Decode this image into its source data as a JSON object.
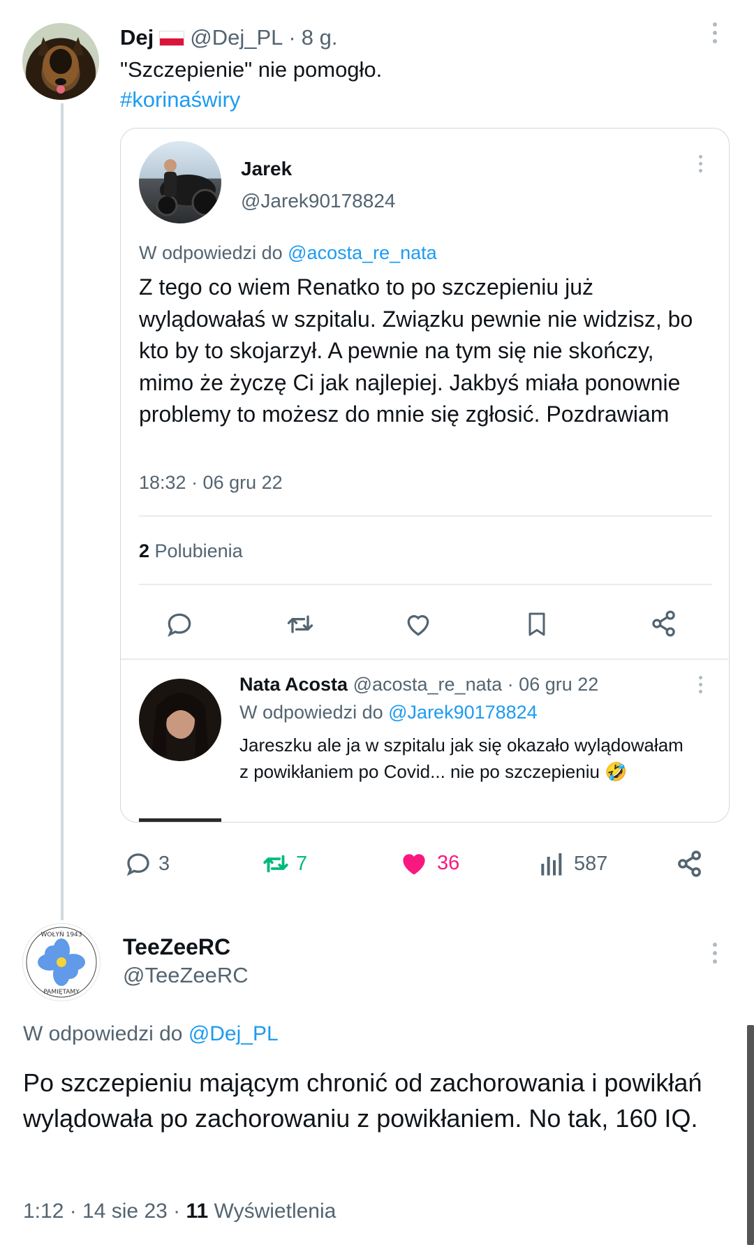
{
  "main_tweet": {
    "author_name": "Dej",
    "author_flag": "🇵🇱",
    "handle": "@Dej_PL",
    "dot": "·",
    "time": "8 g.",
    "text": "\"Szczepienie\" nie pomogło.",
    "hashtag": "#korinaświry",
    "stats": {
      "replies": "3",
      "retweets": "7",
      "likes": "36",
      "views": "587"
    }
  },
  "quoted_tweet": {
    "author_name": "Jarek",
    "handle": "@Jarek90178824",
    "reply_prefix": "W odpowiedzi do",
    "reply_to": "@acosta_re_nata",
    "text": "Z tego co wiem Renatko to po szczepieniu już wylądowałaś w szpitalu. Związku pewnie nie widzisz, bo kto by to skojarzył. A pewnie na tym się nie skończy, mimo że życzę Ci jak najlepiej. Jakbyś miała ponownie problemy to możesz do mnie się zgłosić. Pozdrawiam",
    "timestamp": "18:32 · 06 gru 22",
    "likes_count": "2",
    "likes_label": "Polubienia"
  },
  "nested_reply": {
    "author_name": "Nata Acosta",
    "handle": "@acosta_re_nata",
    "dot": "·",
    "date": "06 gru 22",
    "reply_prefix": "W odpowiedzi do",
    "reply_to": "@Jarek90178824",
    "text": "Jareszku ale ja w szpitalu jak się okazało wylądowałam z powikłaniem po Covid... nie po szczepieniu",
    "emoji": "🤣"
  },
  "reply_tweet": {
    "author_name": "TeeZeeRC",
    "handle": "@TeeZeeRC",
    "reply_prefix": "W odpowiedzi do",
    "reply_to": "@Dej_PL",
    "text": "Po szczepieniu mającym chronić od zachorowania i powikłań wylądowała po zachorowaniu z powikłaniem. No tak, 160 IQ.",
    "time": "1:12 · 14 sie 23 ·",
    "views_count": "11",
    "views_label": "Wyświetlenia",
    "avatar_text_top": "WOŁYŃ 1943",
    "avatar_text_bottom": "PAMIĘTAMY"
  },
  "colors": {
    "like_pink": "#f91880",
    "retweet_green": "#00ba7c",
    "link_blue": "#1d9bf0",
    "muted_gray": "#536471"
  }
}
